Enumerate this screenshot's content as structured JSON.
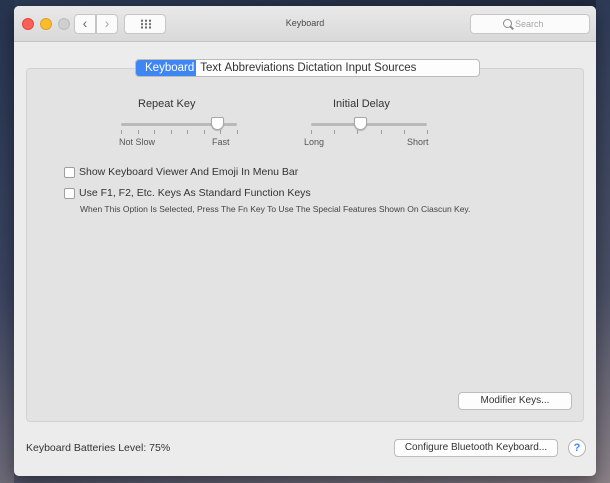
{
  "window": {
    "title": "Keyboard",
    "search_placeholder": "Search"
  },
  "tabs": [
    {
      "label": "Keyboard",
      "selected": true
    },
    {
      "label": "Text"
    },
    {
      "label": "Abbreviations"
    },
    {
      "label": "Dictation"
    },
    {
      "label": "Input Sources"
    }
  ],
  "repeat_key": {
    "label": "Repeat Key",
    "min_label": "Not Slow",
    "max_label": "Fast",
    "value_fraction": 0.83
  },
  "initial_delay": {
    "label": "Initial Delay",
    "min_label": "Long",
    "max_label": "Short",
    "value_fraction": 0.42
  },
  "options": {
    "show_viewer_label": "Show Keyboard Viewer And Emoji In Menu Bar",
    "show_viewer_checked": false,
    "function_keys_label": "Use F1, F2, Etc. Keys As Standard Function Keys",
    "function_keys_checked": false,
    "function_keys_hint": "When This Option Is Selected, Press The Fn Key To Use The Special Features Shown On Ciascun Key."
  },
  "buttons": {
    "modifier_keys": "Modifier Keys...",
    "configure_bluetooth": "Configure Bluetooth Keyboard...",
    "help": "?"
  },
  "status": {
    "battery_label": "Keyboard Batteries Level: 75%"
  },
  "colors": {
    "accent": "#3f86f5",
    "close": "#fc5f57",
    "minimize": "#fdbc2e"
  }
}
